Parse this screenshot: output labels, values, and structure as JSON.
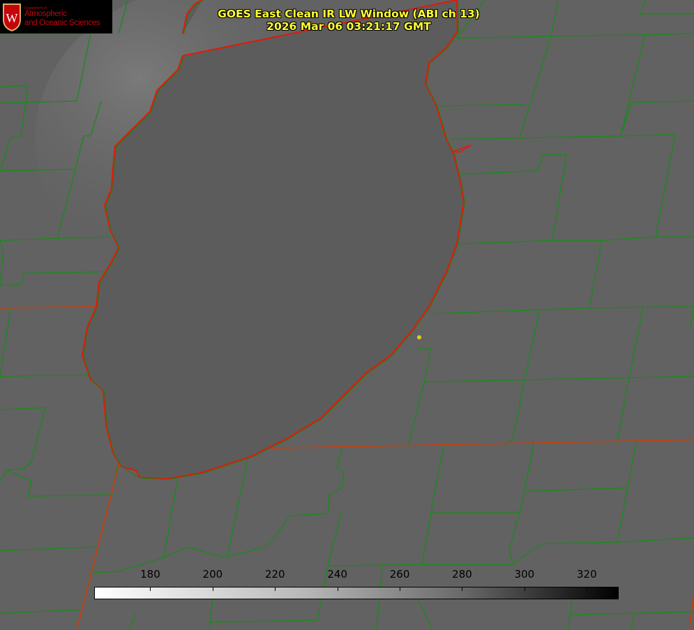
{
  "header": {
    "title_line1": "GOES East Clean IR LW Window (ABI ch 13)",
    "title_line2": "2026 Mar 06 03:21:17 GMT"
  },
  "logo": {
    "department": "Department of",
    "line1": "Atmospheric",
    "line2": "and Oceanic Sciences",
    "crest_letter": "W",
    "color": "#c5050c"
  },
  "colorbar": {
    "ticks": [
      "180",
      "200",
      "220",
      "240",
      "260",
      "280",
      "300",
      "320"
    ],
    "range": [
      162,
      330
    ],
    "colormap": "white (cold) to black (warm)"
  },
  "colors": {
    "county_lines": "#1a8a1a",
    "state_coast_lines": "#e02010",
    "marker": "#d8d020"
  }
}
